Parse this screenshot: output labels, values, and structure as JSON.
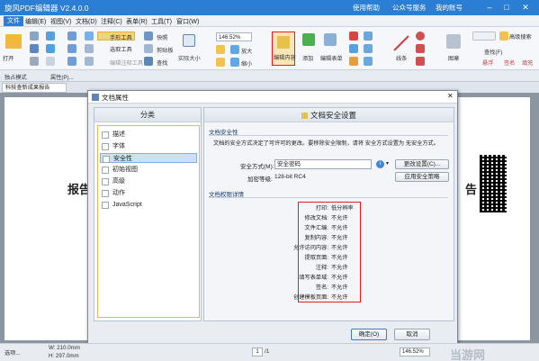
{
  "app": {
    "title": "旋风PDF编辑器 V2.4.0.0",
    "help": "使用帮助",
    "official_account": "公众号服务",
    "login": "我的账号"
  },
  "menu": [
    "文件",
    "编辑(E)",
    "视图(V)",
    "文档(D)",
    "注释(C)",
    "表单(R)",
    "工具(T)",
    "窗口(W)"
  ],
  "ribbon": {
    "open": "打开",
    "open_arrow": "▾",
    "hand_tool": "手形工具",
    "select_text": "选取工具",
    "edit_annot": "编辑注释工具",
    "snapshot": "快照",
    "clipboard": "剪贴板",
    "find": "查找",
    "actual_size": "实际大小",
    "zoom_value": "146.52%",
    "zoom_in": "放大",
    "zoom_out": "缩小",
    "edit_content": "编辑内容",
    "add": "添加",
    "edit_form": "编辑表单",
    "line": "线条",
    "image": "图章",
    "find_right": "查找(F)",
    "adv_search": "高级搜索",
    "bold": "悬浮",
    "lead": "签名",
    "fill": "填充"
  },
  "tabs": {
    "single_mode": "独占模式",
    "properties": "属性(P)..."
  },
  "doc_tab": "科技查新成果报告",
  "page_text": {
    "left": "报告",
    "right": "告"
  },
  "dialog": {
    "title": "文档属性",
    "left_header": "分类",
    "categories": [
      "描述",
      "字体",
      "安全性",
      "初始视图",
      "高级",
      "动作",
      "JavaScript"
    ],
    "right_header": "文档安全设置",
    "security_section": "文档安全性",
    "security_desc": "文档的安全方式决定了可许可的更改。要移除安全限制，请将 安全方式设置为 无安全方式。",
    "method_label": "安全方式(M):",
    "method_value": "安全密码",
    "change_btn": "更改设置(C)...",
    "encrypt_label": "加密等级:",
    "encrypt_value": "128-bit RC4",
    "apply_btn": "应用安全策略",
    "perm_section": "文档权限详情",
    "permissions": [
      {
        "k": "打印:",
        "v": "低分辨率"
      },
      {
        "k": "修改文档:",
        "v": "不允许"
      },
      {
        "k": "文件汇编:",
        "v": "不允许"
      },
      {
        "k": "复制内容:",
        "v": "不允许"
      },
      {
        "k": "允许访问内容:",
        "v": "不允许"
      },
      {
        "k": "提取页面:",
        "v": "不允许"
      },
      {
        "k": "注释:",
        "v": "不允许"
      },
      {
        "k": "填写表单域:",
        "v": "不允许"
      },
      {
        "k": "签名:",
        "v": "不允许"
      },
      {
        "k": "创建模板页面:",
        "v": "不允许"
      }
    ],
    "ok": "确定(O)",
    "cancel": "取消"
  },
  "status": {
    "tools": "选项...",
    "w": "W: 210.0mm",
    "h": "H: 297.0mm",
    "page": "1",
    "pages": "/1",
    "zoom": "146.52%"
  },
  "watermark": "当游网"
}
